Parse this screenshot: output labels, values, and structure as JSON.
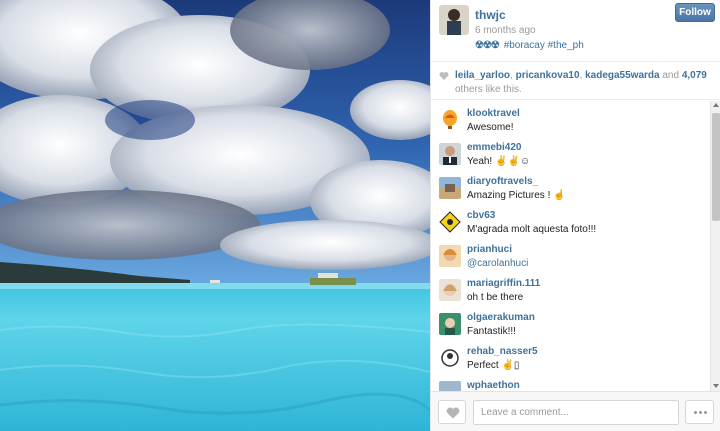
{
  "header": {
    "owner": "thwjc",
    "time": "6 months ago",
    "caption_prefix": "☢☢☢",
    "caption_tags": "#boracay #the_ph",
    "follow_label": "Follow"
  },
  "likes": {
    "users": [
      "leila_yarloo",
      "pricankova10",
      "kadega55warda"
    ],
    "sep1": ", ",
    "sep2": ", ",
    "and_text": " and ",
    "count": "4,079",
    "suffix": " others like this."
  },
  "comments": [
    {
      "user": "klooktravel",
      "text": "Awesome!",
      "avatar_icon": "hot-air-balloon-icon"
    },
    {
      "user": "emmebi420",
      "text": "Yeah! ✌✌☺",
      "avatar_icon": "man-in-suit-avatar"
    },
    {
      "user": "diaryoftravels_",
      "text": "Amazing Pictures ! ☝",
      "avatar_icon": "travel-photo-avatar"
    },
    {
      "user": "cbv63",
      "text": "M'agrada molt aquesta foto!!!",
      "avatar_icon": "road-sign-avatar"
    },
    {
      "user": "prianhuci",
      "text": "@carolanhuci",
      "avatar_icon": "woman-portrait-avatar"
    },
    {
      "user": "mariagriffin.111",
      "text": "oh t be there",
      "avatar_icon": "woman-face-avatar"
    },
    {
      "user": "olgaerakuman",
      "text": "Fantastik!!!",
      "avatar_icon": "green-scene-avatar"
    },
    {
      "user": "rehab_nasser5",
      "text": "Perfect ✌▯",
      "avatar_icon": "sketch-avatar"
    },
    {
      "user": "wphaethon",
      "text": "",
      "avatar_icon": "landscape-avatar"
    }
  ],
  "footer": {
    "comment_placeholder": "Leave a comment..."
  },
  "colors": {
    "link": "#3f729b",
    "follow_button": "#4a76a8",
    "muted": "#9a9a9a"
  }
}
